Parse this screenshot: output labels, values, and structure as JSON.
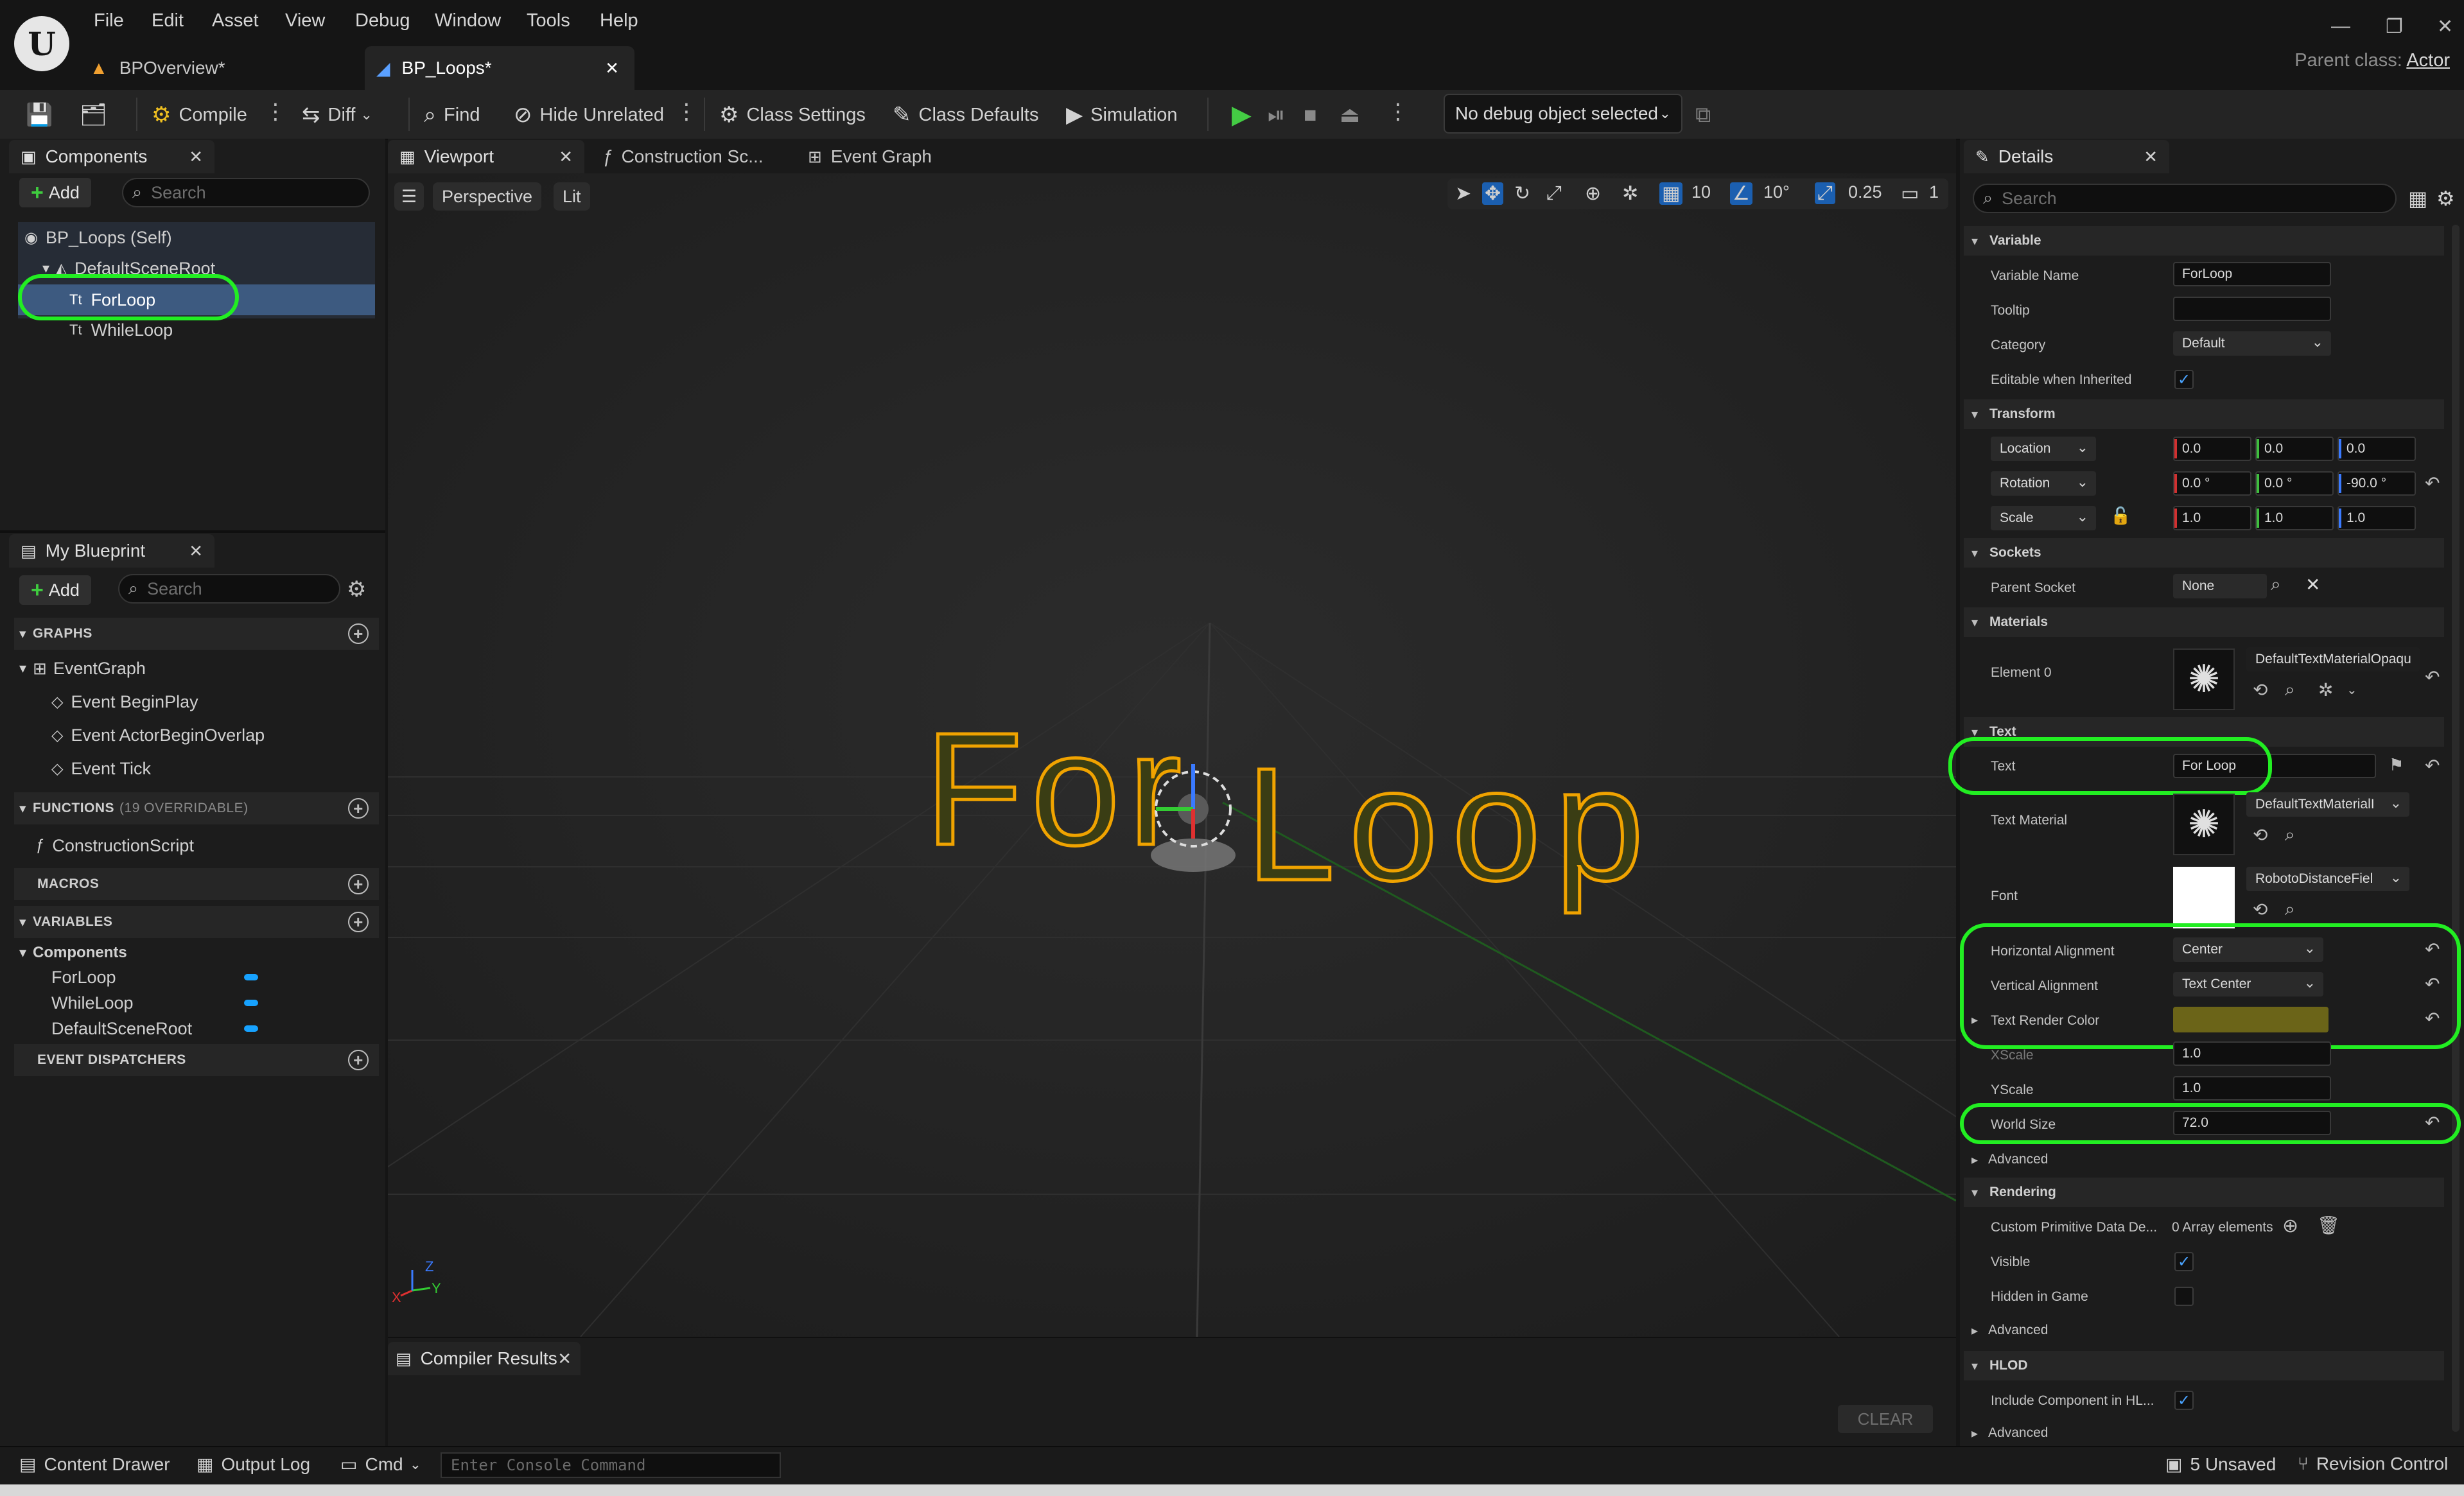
{
  "menu": {
    "items": [
      "File",
      "Edit",
      "Asset",
      "View",
      "Debug",
      "Window",
      "Tools",
      "Help"
    ]
  },
  "tabs": {
    "items": [
      {
        "label": "BPOverview*"
      },
      {
        "label": "BP_Loops*"
      }
    ],
    "parent_class_label": "Parent class:",
    "parent_class_value": "Actor"
  },
  "toolbar": {
    "compile": "Compile",
    "diff": "Diff",
    "find": "Find",
    "hide_unrelated": "Hide Unrelated",
    "class_settings": "Class Settings",
    "class_defaults": "Class Defaults",
    "simulation": "Simulation",
    "debug_object": "No debug object selected"
  },
  "components": {
    "title": "Components",
    "add": "Add",
    "search_placeholder": "Search",
    "tree": [
      {
        "label": "BP_Loops (Self)"
      },
      {
        "label": "DefaultSceneRoot"
      },
      {
        "label": "ForLoop"
      },
      {
        "label": "WhileLoop"
      }
    ]
  },
  "my_blueprint": {
    "title": "My Blueprint",
    "add": "Add",
    "search_placeholder": "Search",
    "graphs_header": "GRAPHS",
    "event_graph": "EventGraph",
    "events": [
      "Event BeginPlay",
      "Event ActorBeginOverlap",
      "Event Tick"
    ],
    "functions_header": "FUNCTIONS",
    "functions_sub": "(19 OVERRIDABLE)",
    "functions": [
      "ConstructionScript"
    ],
    "macros_header": "MACROS",
    "variables_header": "VARIABLES",
    "components_group": "Components",
    "variables": [
      "ForLoop",
      "WhileLoop",
      "DefaultSceneRoot"
    ],
    "dispatchers_header": "EVENT DISPATCHERS"
  },
  "editor_tabs": [
    {
      "label": "Viewport"
    },
    {
      "label": "Construction Sc..."
    },
    {
      "label": "Event Graph"
    }
  ],
  "viewport": {
    "perspective": "Perspective",
    "lit": "Lit",
    "grid_snap": "10",
    "rotation_snap": "10°",
    "scale_snap": "0.25",
    "camera_speed": "1",
    "scene_text": "For Loop",
    "axis_x": "X",
    "axis_y": "Y",
    "axis_z": "Z",
    "text_color": "#3a3d14",
    "outline_color": "#f0a300"
  },
  "compiler": {
    "title": "Compiler Results",
    "clear": "CLEAR"
  },
  "details": {
    "title": "Details",
    "search_placeholder": "Search",
    "sections": {
      "variable": "Variable",
      "transform": "Transform",
      "sockets": "Sockets",
      "materials": "Materials",
      "text": "Text",
      "rendering": "Rendering",
      "hlod": "HLOD"
    },
    "variable_name_label": "Variable Name",
    "variable_name": "ForLoop",
    "tooltip_label": "Tooltip",
    "category_label": "Category",
    "category": "Default",
    "editable_label": "Editable when Inherited",
    "location_label": "Location",
    "rotation_label": "Rotation",
    "scale_label": "Scale",
    "location": [
      "0.0",
      "0.0",
      "0.0"
    ],
    "rotation": [
      "0.0 °",
      "0.0 °",
      "-90.0 °"
    ],
    "scale": [
      "1.0",
      "1.0",
      "1.0"
    ],
    "parent_socket_label": "Parent Socket",
    "parent_socket": "None",
    "element0_label": "Element 0",
    "element0_material": "DefaultTextMaterialOpaqu",
    "text_label": "Text",
    "text_value": "For Loop",
    "text_material_label": "Text Material",
    "text_material": "DefaultTextMaterialI",
    "font_label": "Font",
    "font": "RobotoDistanceFiel",
    "h_align_label": "Horizontal Alignment",
    "h_align": "Center",
    "v_align_label": "Vertical Alignment",
    "v_align": "Text Center",
    "text_render_color_label": "Text Render Color",
    "text_render_color": "#6b6418",
    "xscale_label": "XScale",
    "xscale": "1.0",
    "yscale_label": "YScale",
    "yscale": "1.0",
    "world_size_label": "World Size",
    "world_size": "72.0",
    "advanced": "Advanced",
    "custom_primitive_label": "Custom Primitive Data De...",
    "custom_primitive_value": "0 Array elements",
    "visible_label": "Visible",
    "hidden_in_game_label": "Hidden in Game",
    "include_hlod_label": "Include Component in HL..."
  },
  "statusbar": {
    "content_drawer": "Content Drawer",
    "output_log": "Output Log",
    "cmd": "Cmd",
    "console_placeholder": "Enter Console Command",
    "unsaved": "5 Unsaved",
    "revision_control": "Revision Control"
  },
  "annotation_color": "#22ee22"
}
